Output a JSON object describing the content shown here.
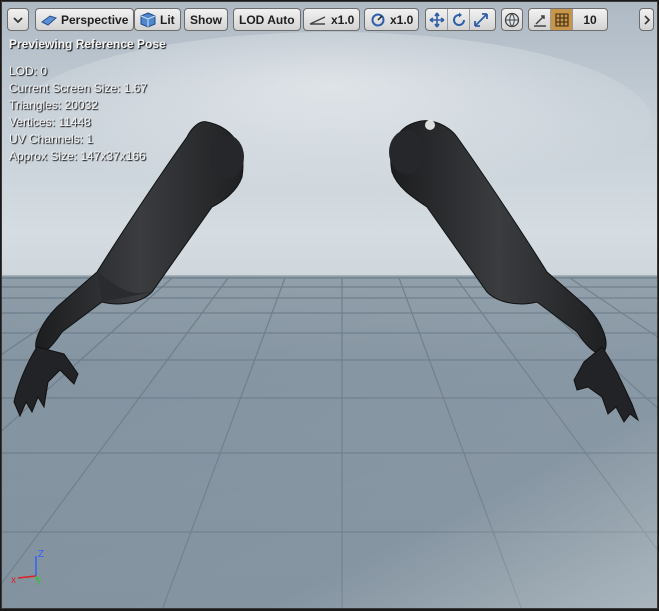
{
  "toolbar": {
    "perspective_label": "Perspective",
    "lit_label": "Lit",
    "show_label": "Show",
    "lod_label": "LOD Auto",
    "fov_value": "x1.0",
    "speed_value": "x1.0",
    "grid_snap_value": "10"
  },
  "viewport": {
    "preview_message": "Previewing Reference Pose"
  },
  "stats": {
    "lod": "LOD: 0",
    "screen_size": "Current Screen Size: 1.67",
    "triangles": "Triangles: 20032",
    "vertices": "Vertices: 11448",
    "uv_channels": "UV Channels: 1",
    "approx_size": "Approx Size: 147x37x166"
  },
  "axis_gizmo": {
    "x_label": "x",
    "y_label": "Y",
    "z_label": "Z"
  },
  "colors": {
    "axis_x": "#e02020",
    "axis_y": "#30c030",
    "axis_z": "#3060ff",
    "snap_active": "#c8964a"
  }
}
